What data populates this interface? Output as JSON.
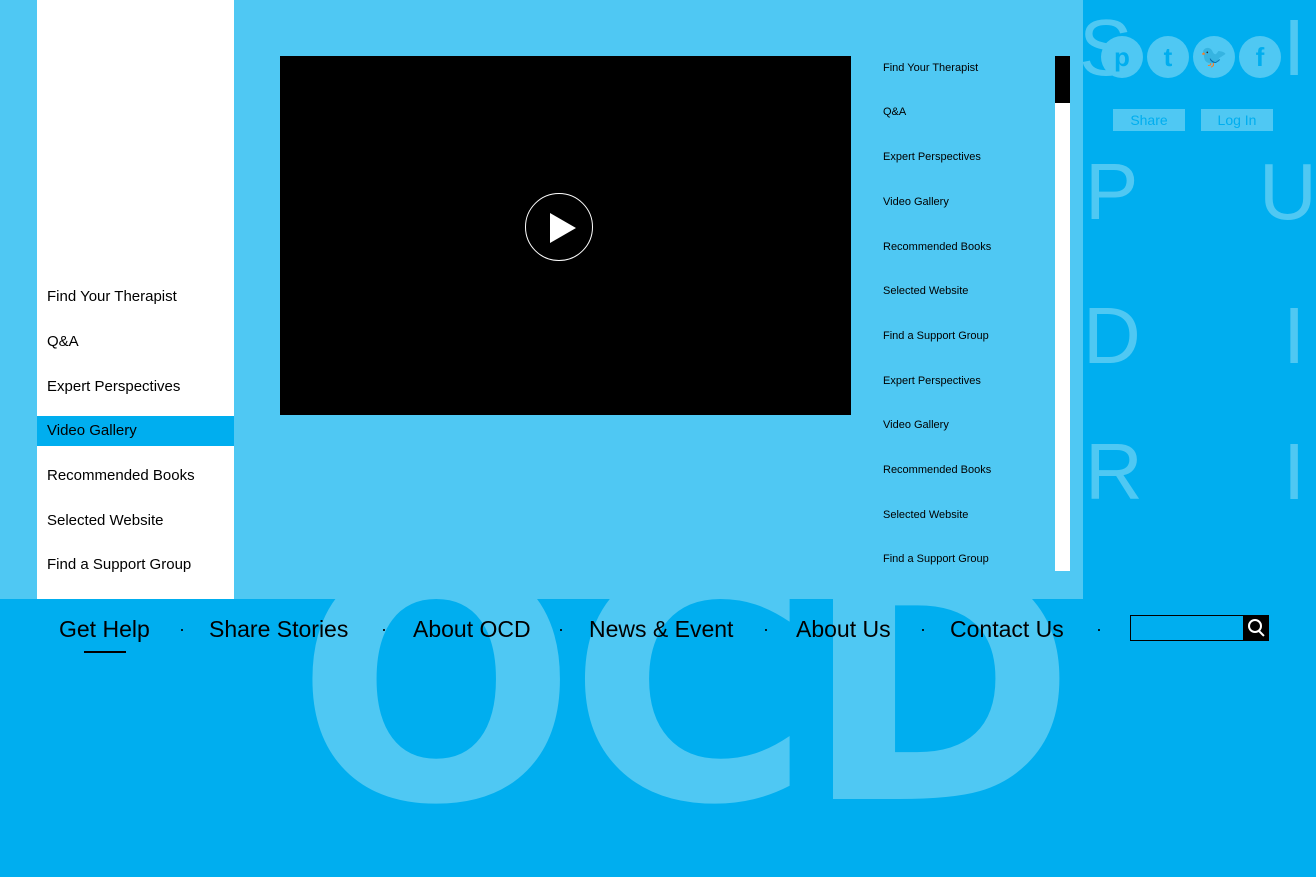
{
  "left_nav": {
    "items": [
      {
        "label": "Find Your Therapist"
      },
      {
        "label": "Q&A"
      },
      {
        "label": "Expert Perspectives"
      },
      {
        "label": "Video Gallery"
      },
      {
        "label": "Recommended Books"
      },
      {
        "label": "Selected Website"
      },
      {
        "label": "Find a Support Group"
      }
    ],
    "active": "Video Gallery"
  },
  "video_list": {
    "items": [
      "Find Your Therapist",
      "Q&A",
      "Expert Perspectives",
      "Video Gallery",
      "Recommended Books",
      "Selected Website",
      "Find a Support Group",
      "Expert Perspectives",
      "Video Gallery",
      "Recommended Books",
      "Selected Website",
      "Find a Support Group"
    ]
  },
  "social": {
    "icons": [
      "pinterest-icon",
      "tumblr-icon",
      "twitter-icon",
      "facebook-icon"
    ],
    "glyphs": [
      "p",
      "t",
      "🐦",
      "f"
    ]
  },
  "header_buttons": {
    "share_story": "Share Story",
    "log_in": "Log In"
  },
  "decor": {
    "letters": [
      "S",
      "I",
      "P",
      "U",
      "D",
      "I",
      "R",
      "I"
    ],
    "background_word": "OCD"
  },
  "main_nav": {
    "items": [
      "Get Help",
      "Share Stories",
      "About OCD",
      "News & Event",
      "About Us",
      "Contact Us"
    ],
    "separator": "·",
    "active": "Get Help"
  },
  "search": {
    "value": "",
    "placeholder": ""
  },
  "colors": {
    "background": "#00aeef",
    "panel": "#4fc8f3",
    "video": "#000000",
    "text": "#000000"
  }
}
